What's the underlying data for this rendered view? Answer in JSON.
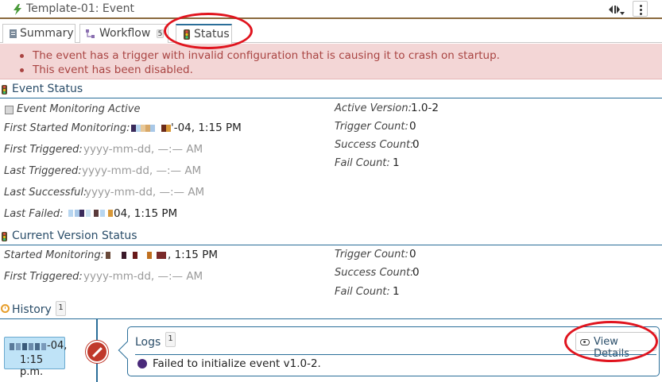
{
  "window": {
    "title": "Template-01: Event"
  },
  "tabs": [
    {
      "label": "Summary"
    },
    {
      "label": "Workflow",
      "badge": "5"
    },
    {
      "label": "Status"
    }
  ],
  "errors": [
    "The event has a trigger with invalid configuration that is causing it to crash on startup.",
    "This event has been disabled."
  ],
  "event_status": {
    "heading": "Event Status",
    "monitoring_active_label": "Event Monitoring Active",
    "first_started_label": "First Started Monitoring:",
    "first_started_value": "'-04, 1:15 PM",
    "first_triggered_label": "First Triggered:",
    "first_triggered_value": "yyyy-mm-dd, —:— AM",
    "last_triggered_label": "Last Triggered:",
    "last_triggered_value": "yyyy-mm-dd, —:— AM",
    "last_successful_label": "Last Successful:",
    "last_successful_value": "yyyy-mm-dd, —:— AM",
    "last_failed_label": "Last Failed:",
    "last_failed_value": "04, 1:15 PM",
    "active_version_label": "Active Version:",
    "active_version_value": "1.0-2",
    "trigger_count_label": "Trigger Count:",
    "trigger_count_value": "0",
    "success_count_label": "Success Count:",
    "success_count_value": "0",
    "fail_count_label": "Fail Count:",
    "fail_count_value": "1"
  },
  "current_version_status": {
    "heading": "Current Version Status",
    "started_label": "Started Monitoring:",
    "started_value": ", 1:15 PM",
    "first_triggered_label": "First Triggered:",
    "first_triggered_value": "yyyy-mm-dd, —:— AM",
    "trigger_count_label": "Trigger Count:",
    "trigger_count_value": "0",
    "success_count_label": "Success Count:",
    "success_count_value": "0",
    "fail_count_label": "Fail Count:",
    "fail_count_value": "1"
  },
  "history": {
    "heading": "History",
    "count": "1",
    "entry_date": "-04,",
    "entry_time": "1:15 p.m.",
    "logs_title": "Logs",
    "logs_count": "1",
    "view_details_label": "View Details",
    "log_message": "Failed to initialize event v1.0-2."
  },
  "colors": {
    "accent": "#2a6e99",
    "error_text": "#a94442",
    "error_bg": "#f3d6d6",
    "highlight_circle": "#e0141e"
  }
}
